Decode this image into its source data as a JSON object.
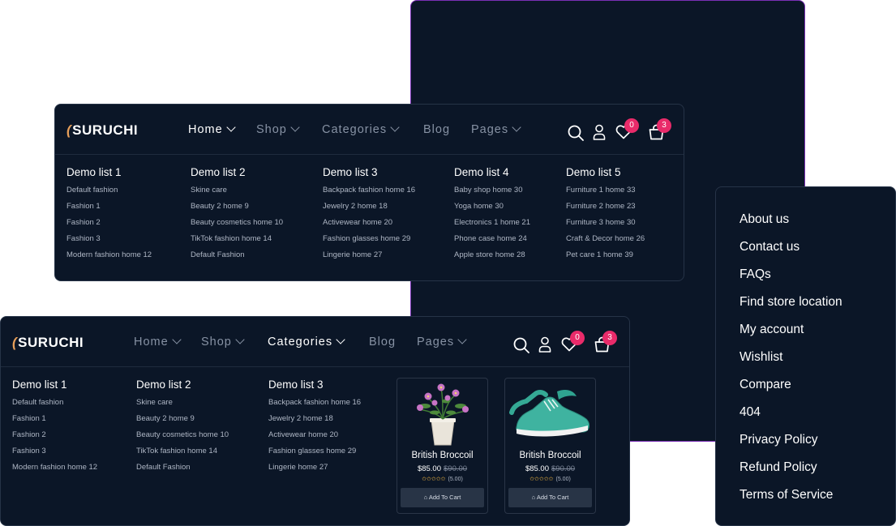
{
  "brand": {
    "logo_text": "SURUCHI"
  },
  "nav": {
    "home": "Home",
    "shop": "Shop",
    "categories": "Categories",
    "blog": "Blog",
    "pages": "Pages"
  },
  "header_counts": {
    "wishlist": "0",
    "cart": "3"
  },
  "colors": {
    "bg": "#0b1627",
    "badge": "#e92b6a",
    "accent_border": "#7a2fb5",
    "star": "#f3b73f"
  },
  "icons": [
    "search-icon",
    "user-icon",
    "heart-icon",
    "bag-icon",
    "chevron-down-icon",
    "star-icon",
    "cart-icon"
  ],
  "home_menu": {
    "columns": [
      {
        "title": "Demo list 1",
        "items": [
          "Default fashion",
          "Fashion 1",
          "Fashion 2",
          "Fashion 3",
          "Modern fashion home 12"
        ]
      },
      {
        "title": "Demo list 2",
        "items": [
          "Skine care",
          "Beauty 2 home 9",
          "Beauty cosmetics home 10",
          "TikTok fashion home 14",
          "Default Fashion"
        ]
      },
      {
        "title": "Demo list 3",
        "items": [
          "Backpack fashion home 16",
          "Jewelry 2 home 18",
          "Activewear home 20",
          "Fashion glasses home 29",
          "Lingerie home 27"
        ]
      },
      {
        "title": "Demo list 4",
        "items": [
          "Baby shop home 30",
          "Yoga home 30",
          "Electronics 1 home 21",
          "Phone case home 24",
          "Apple store home 28"
        ]
      },
      {
        "title": "Demo list 5",
        "items": [
          "Furniture 1 home 33",
          "Furniture 2 home 23",
          "Furniture 3 home 30",
          "Craft & Decor home 26",
          "Pet care 1 home 39"
        ]
      }
    ]
  },
  "categories_menu": {
    "columns": [
      {
        "title": "Demo list 1",
        "items": [
          "Default fashion",
          "Fashion 1",
          "Fashion 2",
          "Fashion 3",
          "Modern fashion home 12"
        ]
      },
      {
        "title": "Demo list 2",
        "items": [
          "Skine care",
          "Beauty 2 home 9",
          "Beauty cosmetics home 10",
          "TikTok fashion home 14",
          "Default Fashion"
        ]
      },
      {
        "title": "Demo list 3",
        "items": [
          "Backpack fashion home 16",
          "Jewelry 2 home 18",
          "Activewear home 20",
          "Fashion glasses home 29",
          "Lingerie home 27"
        ]
      }
    ],
    "products": [
      {
        "name": "British Broccoil",
        "price": "$85.00",
        "old_price": "$90.00",
        "rating": 5,
        "rating_text": "(5.00)",
        "button": "Add To Cart",
        "image": "flower-pot-image"
      },
      {
        "name": "British Broccoil",
        "price": "$85.00",
        "old_price": "$90.00",
        "rating": 5,
        "rating_text": "(5.00)",
        "button": "Add To Cart",
        "image": "sneaker-image"
      }
    ]
  },
  "pages_menu": {
    "items": [
      "About us",
      "Contact us",
      "FAQs",
      "Find store location",
      "My account",
      "Wishlist",
      "Compare",
      "404",
      "Privacy Policy",
      "Refund Policy",
      "Terms of Service"
    ]
  }
}
